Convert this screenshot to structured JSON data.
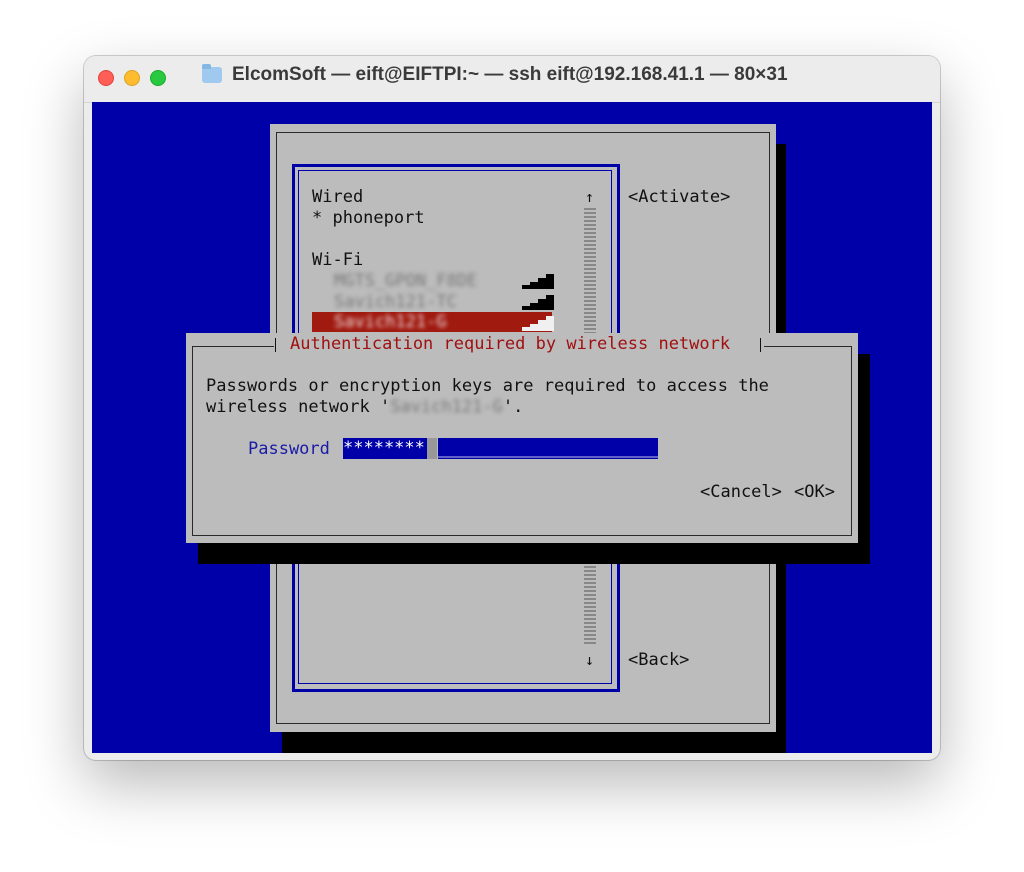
{
  "window": {
    "title": "ElcomSoft — eift@EIFTPI:~ — ssh eift@192.168.41.1 — 80×31"
  },
  "nmtui": {
    "activate_label": "<Activate>",
    "back_label": "<Back>",
    "scroll_up": "↑",
    "scroll_down": "↓",
    "list": {
      "wired_header": "Wired",
      "wired_item": "* phoneport",
      "wifi_header": "Wi-Fi",
      "wifi_items": [
        "MGTS_GPON_F8DE",
        "Savich121-TC",
        "Savich121-G"
      ]
    }
  },
  "dialog": {
    "title": "Authentication required by wireless network",
    "message_line1": "Passwords or encryption keys are required to access the",
    "message_line2_prefix": "wireless network '",
    "message_network": "Savich121-G",
    "message_line2_suffix": "'.",
    "password_label": "Password",
    "password_value": "********",
    "cancel_label": "<Cancel>",
    "ok_label": "<OK>"
  },
  "colors": {
    "terminal_bg": "#0000a8",
    "panel_gray": "#bcbcbc",
    "selection_red": "#a01a10",
    "dialog_title_red": "#a01010"
  }
}
